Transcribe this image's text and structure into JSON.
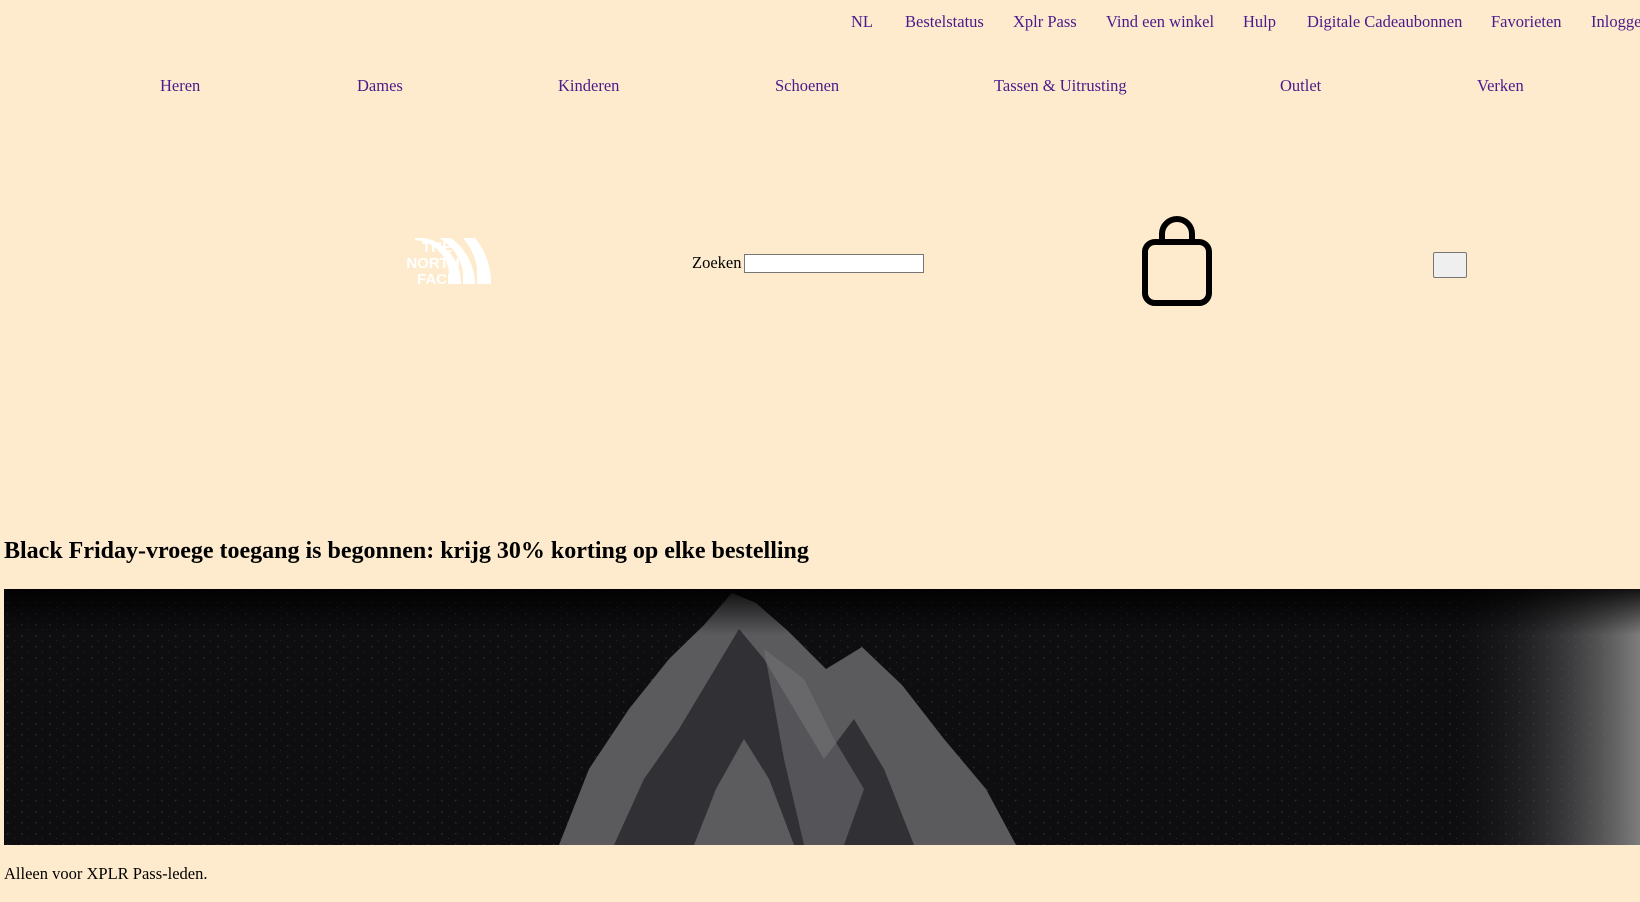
{
  "utility_nav": [
    {
      "label": "NL"
    },
    {
      "label": "Bestelstatus"
    },
    {
      "label": "Xplr Pass"
    },
    {
      "label": "Vind een winkel"
    },
    {
      "label": "Hulp"
    },
    {
      "label": "Digitale Cadeaubonnen"
    },
    {
      "label": "Favorieten"
    },
    {
      "label": "Inlogge"
    }
  ],
  "main_nav": [
    {
      "label": "Heren"
    },
    {
      "label": "Dames"
    },
    {
      "label": "Kinderen"
    },
    {
      "label": "Schoenen"
    },
    {
      "label": "Tassen & Uitrusting"
    },
    {
      "label": "Outlet"
    },
    {
      "label": "Verken"
    }
  ],
  "header": {
    "logo_text": [
      "THE",
      "NORTH",
      "FACE"
    ],
    "search_label": "Zoeken",
    "search_value": "",
    "cart_icon": "shopping-bag-icon",
    "menu_icon": "menu-button"
  },
  "promo": {
    "title": "Black Friday-vroege toegang is begonnen: krijg 30% korting op elke bestelling",
    "note": "Alleen voor XPLR Pass-leden."
  },
  "colors": {
    "background": "#feebcd",
    "link": "#4b1a8c",
    "hero_dark": "#0e0e11",
    "hero_rock": "#6a6a6a"
  }
}
